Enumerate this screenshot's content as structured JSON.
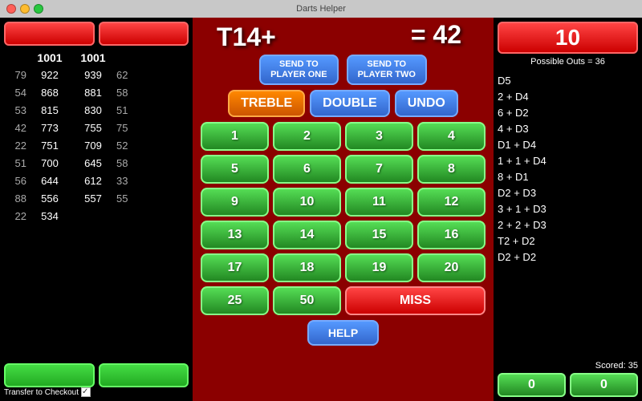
{
  "titleBar": {
    "title": "Darts Helper"
  },
  "leftPanel": {
    "topButtons": [
      {
        "label": "",
        "id": "left-top-btn-1"
      },
      {
        "label": "",
        "id": "left-top-btn-2"
      }
    ],
    "scores": {
      "headers": {
        "col1": "",
        "p1": "1001",
        "p2": "1001",
        "col4": ""
      },
      "rows": [
        {
          "col1": "79",
          "p1": "922",
          "p2": "939",
          "col4": "62"
        },
        {
          "col1": "54",
          "p1": "868",
          "p2": "881",
          "col4": "58"
        },
        {
          "col1": "53",
          "p1": "815",
          "p2": "830",
          "col4": "51"
        },
        {
          "col1": "42",
          "p1": "773",
          "p2": "755",
          "col4": "75"
        },
        {
          "col1": "22",
          "p1": "751",
          "p2": "709",
          "col4": "52"
        },
        {
          "col1": "51",
          "p1": "700",
          "p2": "645",
          "col4": "58"
        },
        {
          "col1": "56",
          "p1": "644",
          "p2": "612",
          "col4": "33"
        },
        {
          "col1": "88",
          "p1": "556",
          "p2": "557",
          "col4": "55"
        },
        {
          "col1": "22",
          "p1": "534",
          "p2": "",
          "col4": ""
        }
      ]
    },
    "bottomButtons": [
      {
        "label": "",
        "id": "left-bottom-btn-1"
      },
      {
        "label": "",
        "id": "left-bottom-btn-2"
      }
    ],
    "checkoutLabel": "Transfer to Checkout"
  },
  "centerPanel": {
    "formula": "T14+",
    "equals": "= 42",
    "sendToPlayerOne": {
      "line1": "SEND TO",
      "line2": "PLAYER ONE"
    },
    "sendToPlayerTwo": {
      "line1": "SEND TO",
      "line2": "PLAYER TWO"
    },
    "trebleLabel": "TREBLE",
    "doubleLabel": "DOUBLE",
    "undoLabel": "UNDO",
    "numbers": [
      "1",
      "2",
      "3",
      "4",
      "5",
      "6",
      "7",
      "8",
      "9",
      "10",
      "11",
      "12",
      "13",
      "14",
      "15",
      "16",
      "17",
      "18",
      "19",
      "20",
      "25",
      "50"
    ],
    "missLabel": "MISS",
    "helpLabel": "HELP"
  },
  "rightPanel": {
    "score": "10",
    "possibleOuts": "Possible Outs = 36",
    "outs": [
      "D5",
      "2 + D4",
      "6 + D2",
      "4 + D3",
      "D1 + D4",
      "1 + 1 + D4",
      "8 + D1",
      "D2 + D3",
      "3 + 1 + D3",
      "2 + 2 + D3",
      "T2 + D2",
      "D2 + D2"
    ],
    "scoredLabel": "Scored: 35",
    "bottomScores": [
      "0",
      "0"
    ]
  }
}
